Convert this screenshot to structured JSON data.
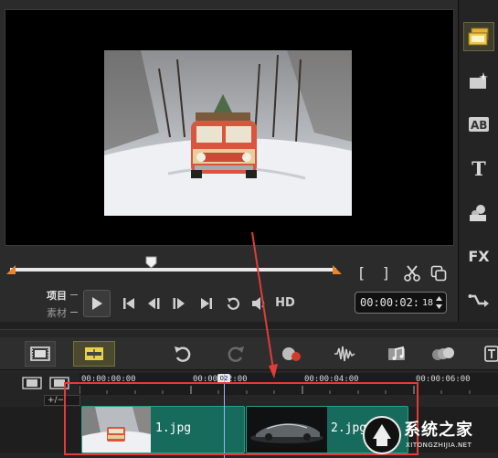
{
  "preview": {
    "mode_project": "项目",
    "mode_clip": "素材",
    "hd": "HD",
    "mark_in": "[",
    "mark_out": "]",
    "timecode": "00:00:02:",
    "timecode_frames": "18"
  },
  "icons": {
    "play": "play-icon",
    "home": "go-to-start-icon",
    "prev": "previous-frame-icon",
    "next": "next-frame-icon",
    "end": "go-to-end-icon",
    "repeat": "repeat-icon",
    "volume": "volume-icon",
    "split": "scissors-icon",
    "copy": "copy-icon"
  },
  "toolbar_right": {
    "title_tool": "T",
    "fx_tool": "FX"
  },
  "timeline": {
    "zoom_label": "+/−",
    "ruler_labels": [
      "00:00:00:00",
      "00:00:02:00",
      "00:00:04:00",
      "00:00:06:00"
    ],
    "playhead_flag": "02",
    "clips": [
      {
        "label": "1.jpg"
      },
      {
        "label": "2.jpg"
      }
    ]
  },
  "watermark": {
    "text": "系统之家",
    "sub": "XITONGZHIJIA.NET"
  },
  "colors": {
    "clip_fill": "#176b5d",
    "highlight": "#e23b3b",
    "trim_marker": "#e8862b"
  }
}
